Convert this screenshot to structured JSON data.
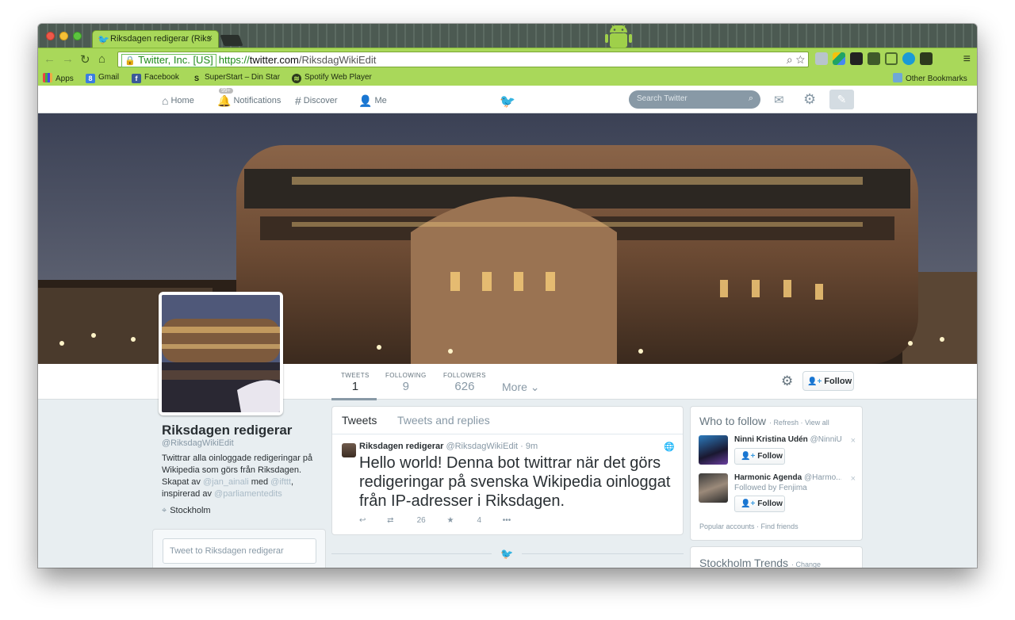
{
  "browser": {
    "tab_title": "Riksdagen redigerar (Riks",
    "ev_label": "Twitter, Inc. [US]",
    "url_scheme": "https://",
    "url_host": "twitter.com",
    "url_path": "/RiksdagWikiEdit",
    "bookmarks": [
      "Apps",
      "Gmail",
      "Facebook",
      "SuperStart – Din Star",
      "Spotify Web Player"
    ],
    "other_bookmarks": "Other Bookmarks"
  },
  "twitter_nav": {
    "home": "Home",
    "notifications": "Notifications",
    "notifications_count": "99+",
    "discover": "Discover",
    "me": "Me",
    "search_placeholder": "Search Twitter"
  },
  "profile": {
    "name": "Riksdagen redigerar",
    "handle": "@RiksdagWikiEdit",
    "bio_text": "Twittrar alla oinloggade redigeringar på Wikipedia som görs från Riksdagen. Skapat av",
    "bio_link1": "@jan_ainali",
    "bio_mid": "med",
    "bio_link2": "@ifttt",
    "bio_mid2": ", inspirerad av",
    "bio_link3": "@parliamentedits",
    "location": "Stockholm",
    "tweetbox_placeholder": "Tweet to Riksdagen redigerar"
  },
  "stats": {
    "tweets_label": "TWEETS",
    "tweets": "1",
    "following_label": "FOLLOWING",
    "following": "9",
    "followers_label": "FOLLOWERS",
    "followers": "626",
    "more": "More",
    "follow_button": "Follow"
  },
  "timeline": {
    "tab_tweets": "Tweets",
    "tab_replies": "Tweets and replies",
    "tweet": {
      "author": "Riksdagen redigerar",
      "meta": "@RiksdagWikiEdit · 9m",
      "text": "Hello world! Denna bot twittrar när det görs redigeringar på svenska Wikipedia oinloggat från IP-adresser i Riksdagen.",
      "retweets": "26",
      "favorites": "4"
    }
  },
  "who_to_follow": {
    "title": "Who to follow",
    "refresh": "Refresh",
    "view_all": "View all",
    "items": [
      {
        "name": "Ninni Kristina Udén",
        "handle": "@NinniU",
        "sub": "",
        "button": "Follow"
      },
      {
        "name": "Harmonic Agenda",
        "handle": "@Harmo...",
        "sub": "Followed by Fenjima",
        "button": "Follow"
      }
    ],
    "popular": "Popular accounts",
    "find_friends": "Find friends"
  },
  "trends": {
    "title": "Stockholm Trends",
    "change": "Change"
  },
  "colors": {
    "browser_accent": "#a9d85a",
    "twitter_blue": "#2b9be0",
    "follow_icon": "#3c9be0"
  }
}
